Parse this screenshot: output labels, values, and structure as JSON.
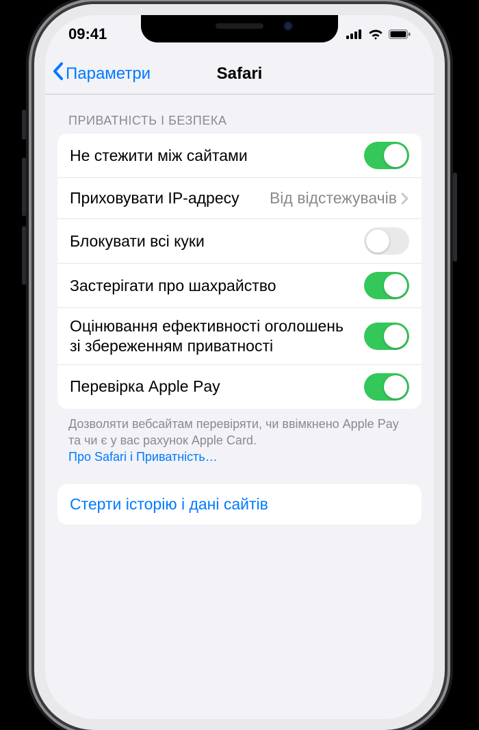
{
  "status": {
    "time": "09:41"
  },
  "nav": {
    "back": "Параметри",
    "title": "Safari"
  },
  "section_header": "ПРИВАТНІСТЬ І БЕЗПЕКА",
  "rows": {
    "track": {
      "label": "Не стежити між сайтами",
      "on": true
    },
    "hideip": {
      "label": "Приховувати IP-адресу",
      "value": "Від відстежувачів"
    },
    "cookies": {
      "label": "Блокувати всі куки",
      "on": false
    },
    "fraud": {
      "label": "Застерігати про шахрайство",
      "on": true
    },
    "ads": {
      "label": "Оцінювання ефективності оголошень зі збереженням приватності",
      "on": true
    },
    "applepay": {
      "label": "Перевірка Apple Pay",
      "on": true
    }
  },
  "footer": {
    "text": "Дозволяти вебсайтам перевіряти, чи ввімкнено Apple Pay та чи є у вас рахунок Apple Card.",
    "link": "Про Safari і Приватність…"
  },
  "clear_action": "Стерти історію і дані сайтів"
}
